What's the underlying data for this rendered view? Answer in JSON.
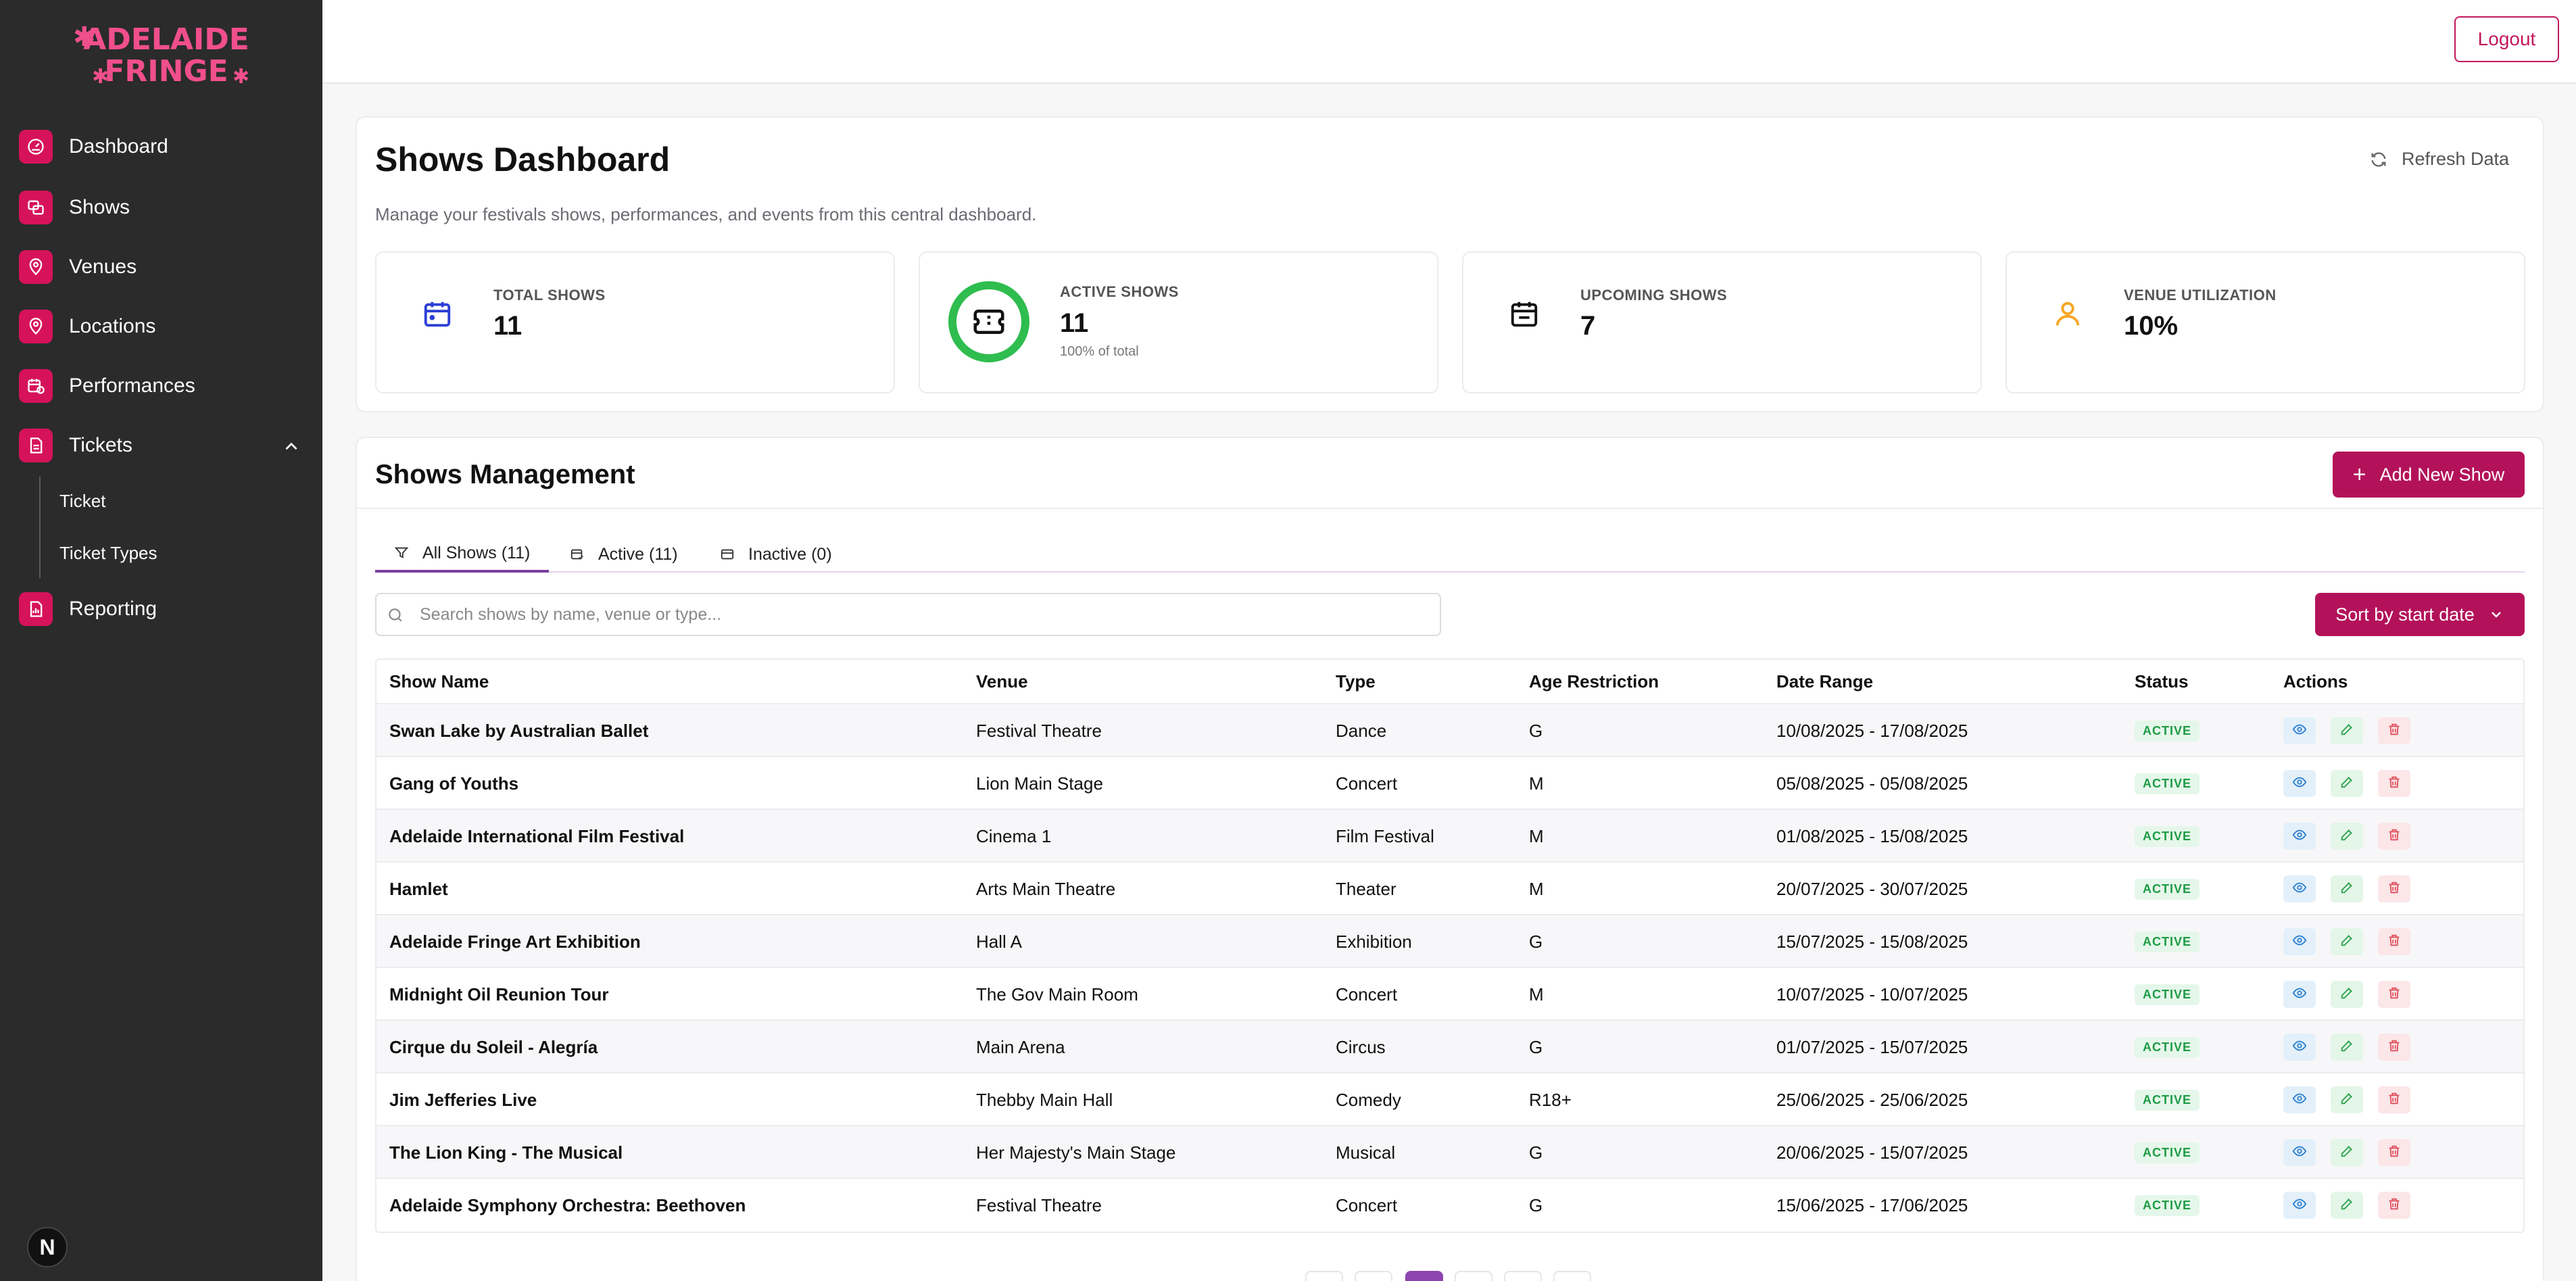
{
  "brand": {
    "logo_line1": "ADELAIDE",
    "logo_line2": "FRINGE",
    "accent": "#d6135a"
  },
  "sidebar": {
    "items": [
      {
        "label": "Dashboard",
        "icon": "gauge-icon"
      },
      {
        "label": "Shows",
        "icon": "shows-icon"
      },
      {
        "label": "Venues",
        "icon": "map-pin-icon"
      },
      {
        "label": "Locations",
        "icon": "map-pin-icon"
      },
      {
        "label": "Performances",
        "icon": "calendar-clock-icon"
      },
      {
        "label": "Tickets",
        "icon": "ticket-file-icon"
      },
      {
        "label": "Reporting",
        "icon": "report-icon"
      }
    ],
    "sub_items": [
      {
        "label": "Ticket"
      },
      {
        "label": "Ticket Types"
      }
    ],
    "next_badge": "N"
  },
  "topbar": {
    "logout_label": "Logout"
  },
  "dashboard": {
    "title": "Shows Dashboard",
    "subtitle": "Manage your festivals shows, performances, and events from this central dashboard.",
    "refresh_label": "Refresh Data",
    "stats": [
      {
        "label": "TOTAL SHOWS",
        "value": "11"
      },
      {
        "label": "ACTIVE SHOWS",
        "value": "11",
        "note": "100% of total"
      },
      {
        "label": "UPCOMING SHOWS",
        "value": "7"
      },
      {
        "label": "VENUE UTILIZATION",
        "value": "10%"
      }
    ]
  },
  "management": {
    "title": "Shows Management",
    "add_label": "Add New Show",
    "tabs": [
      {
        "label": "All Shows (11)"
      },
      {
        "label": "Active (11)"
      },
      {
        "label": "Inactive (0)"
      }
    ],
    "search_placeholder": "Search shows by name, venue or type...",
    "sort_label": "Sort by start date",
    "columns": [
      "Show Name",
      "Venue",
      "Type",
      "Age Restriction",
      "Date Range",
      "Status",
      "Actions"
    ],
    "rows": [
      {
        "name": "Swan Lake by Australian Ballet",
        "venue": "Festival Theatre",
        "type": "Dance",
        "age": "G",
        "dates": "10/08/2025 - 17/08/2025",
        "status": "ACTIVE"
      },
      {
        "name": "Gang of Youths",
        "venue": "Lion Main Stage",
        "type": "Concert",
        "age": "M",
        "dates": "05/08/2025 - 05/08/2025",
        "status": "ACTIVE"
      },
      {
        "name": "Adelaide International Film Festival",
        "venue": "Cinema 1",
        "type": "Film Festival",
        "age": "M",
        "dates": "01/08/2025 - 15/08/2025",
        "status": "ACTIVE"
      },
      {
        "name": "Hamlet",
        "venue": "Arts Main Theatre",
        "type": "Theater",
        "age": "M",
        "dates": "20/07/2025 - 30/07/2025",
        "status": "ACTIVE"
      },
      {
        "name": "Adelaide Fringe Art Exhibition",
        "venue": "Hall A",
        "type": "Exhibition",
        "age": "G",
        "dates": "15/07/2025 - 15/08/2025",
        "status": "ACTIVE"
      },
      {
        "name": "Midnight Oil Reunion Tour",
        "venue": "The Gov Main Room",
        "type": "Concert",
        "age": "M",
        "dates": "10/07/2025 - 10/07/2025",
        "status": "ACTIVE"
      },
      {
        "name": "Cirque du Soleil - Alegría",
        "venue": "Main Arena",
        "type": "Circus",
        "age": "G",
        "dates": "01/07/2025 - 15/07/2025",
        "status": "ACTIVE"
      },
      {
        "name": "Jim Jefferies Live",
        "venue": "Thebby Main Hall",
        "type": "Comedy",
        "age": "R18+",
        "dates": "25/06/2025 - 25/06/2025",
        "status": "ACTIVE"
      },
      {
        "name": "The Lion King - The Musical",
        "venue": "Her Majesty's Main Stage",
        "type": "Musical",
        "age": "G",
        "dates": "20/06/2025 - 15/07/2025",
        "status": "ACTIVE"
      },
      {
        "name": "Adelaide Symphony Orchestra: Beethoven",
        "venue": "Festival Theatre",
        "type": "Concert",
        "age": "G",
        "dates": "15/06/2025 - 17/06/2025",
        "status": "ACTIVE"
      }
    ]
  }
}
